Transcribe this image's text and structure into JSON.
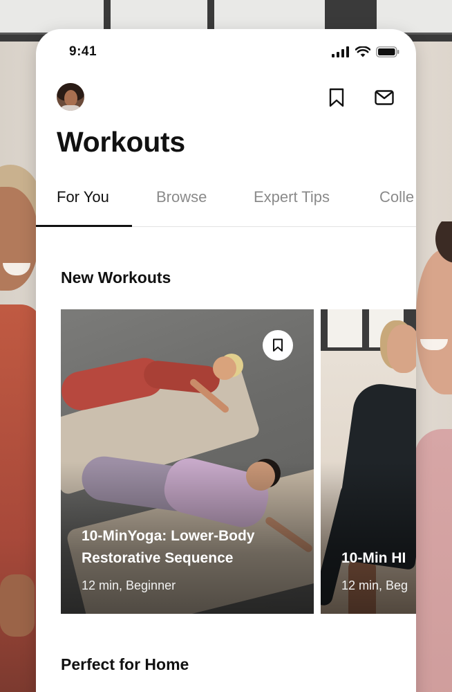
{
  "status_bar": {
    "time": "9:41"
  },
  "header": {
    "title": "Workouts"
  },
  "tabs": [
    {
      "label": "For You",
      "active": true
    },
    {
      "label": "Browse",
      "active": false
    },
    {
      "label": "Expert Tips",
      "active": false
    },
    {
      "label": "Colle",
      "active": false
    }
  ],
  "sections": {
    "new_workouts": {
      "title": "New Workouts",
      "cards": [
        {
          "title": "10-MinYoga: Lower-Body Restorative Sequence",
          "meta": "12 min, Beginner"
        },
        {
          "title": "10-Min HI",
          "meta": "12 min, Beg"
        }
      ]
    },
    "perfect_for_home": {
      "title": "Perfect for Home"
    }
  },
  "icons": {
    "signal": "cellular-signal-icon",
    "wifi": "wifi-icon",
    "battery": "battery-icon",
    "bookmark": "bookmark-icon",
    "mail": "mail-icon"
  },
  "colors": {
    "text_primary": "#111111",
    "text_inactive": "#8a8a8a",
    "surface": "#ffffff",
    "divider": "#e2e2e2"
  }
}
